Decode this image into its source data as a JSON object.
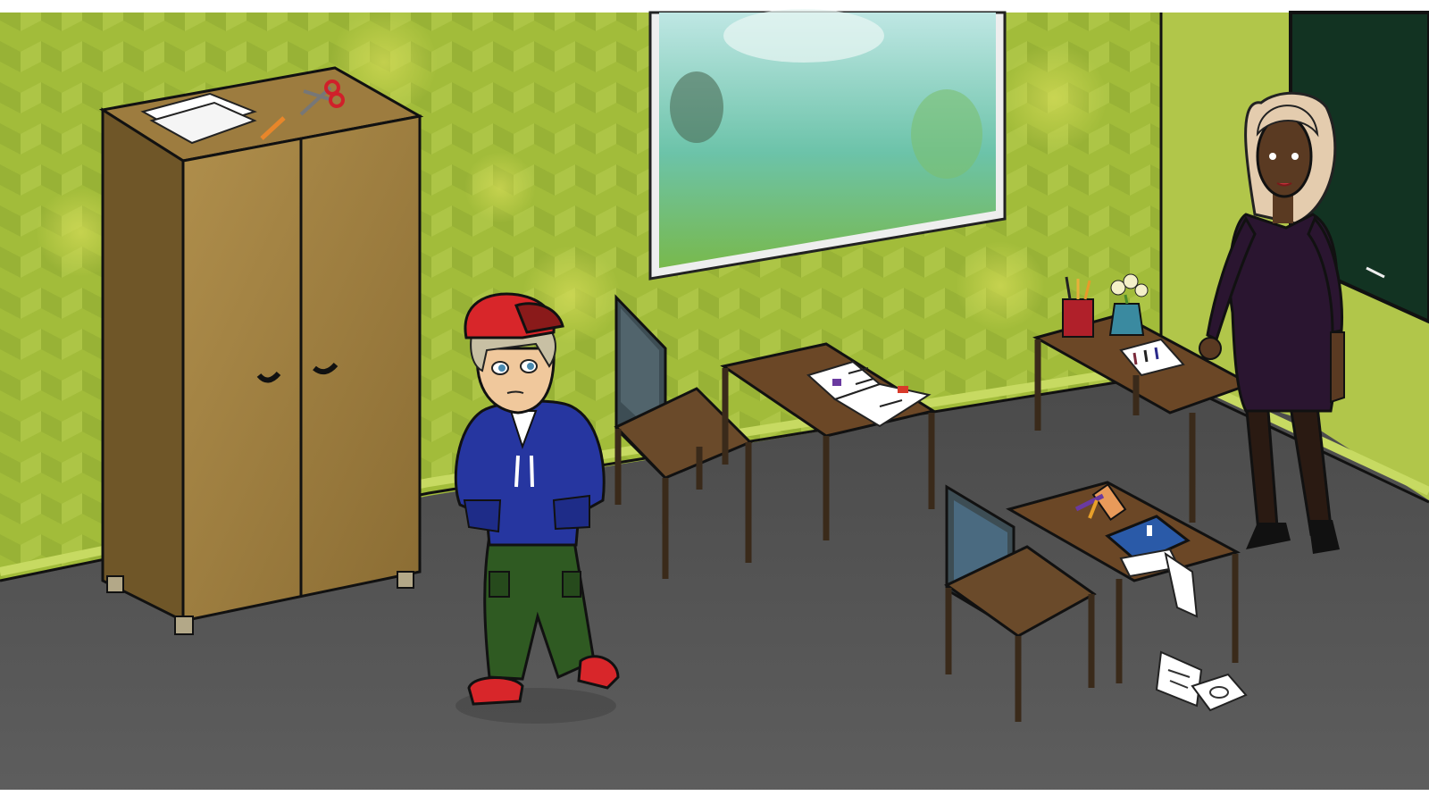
{
  "scene": {
    "setting": "classroom",
    "wall_color": "#a8bf3c",
    "floor_color": "#555555",
    "chalkboard_color": "#123322"
  },
  "characters": [
    {
      "role": "boy-student",
      "cap_color": "#d8262a",
      "hoodie_color": "#2636a0",
      "pants_color": "#2f5a22",
      "shoe_color": "#d8262a"
    },
    {
      "role": "teacher",
      "hair_color": "#e4ccae",
      "dress_color": "#2a1530"
    }
  ],
  "objects": [
    "wardrobe",
    "window",
    "chalkboard",
    "chair-left",
    "desk-left",
    "open-notebook",
    "teacher-desk",
    "pencil-cup",
    "flower-vase",
    "papers",
    "chair-front",
    "desk-front",
    "blue-book",
    "scattered-papers",
    "scissors",
    "pencil"
  ]
}
